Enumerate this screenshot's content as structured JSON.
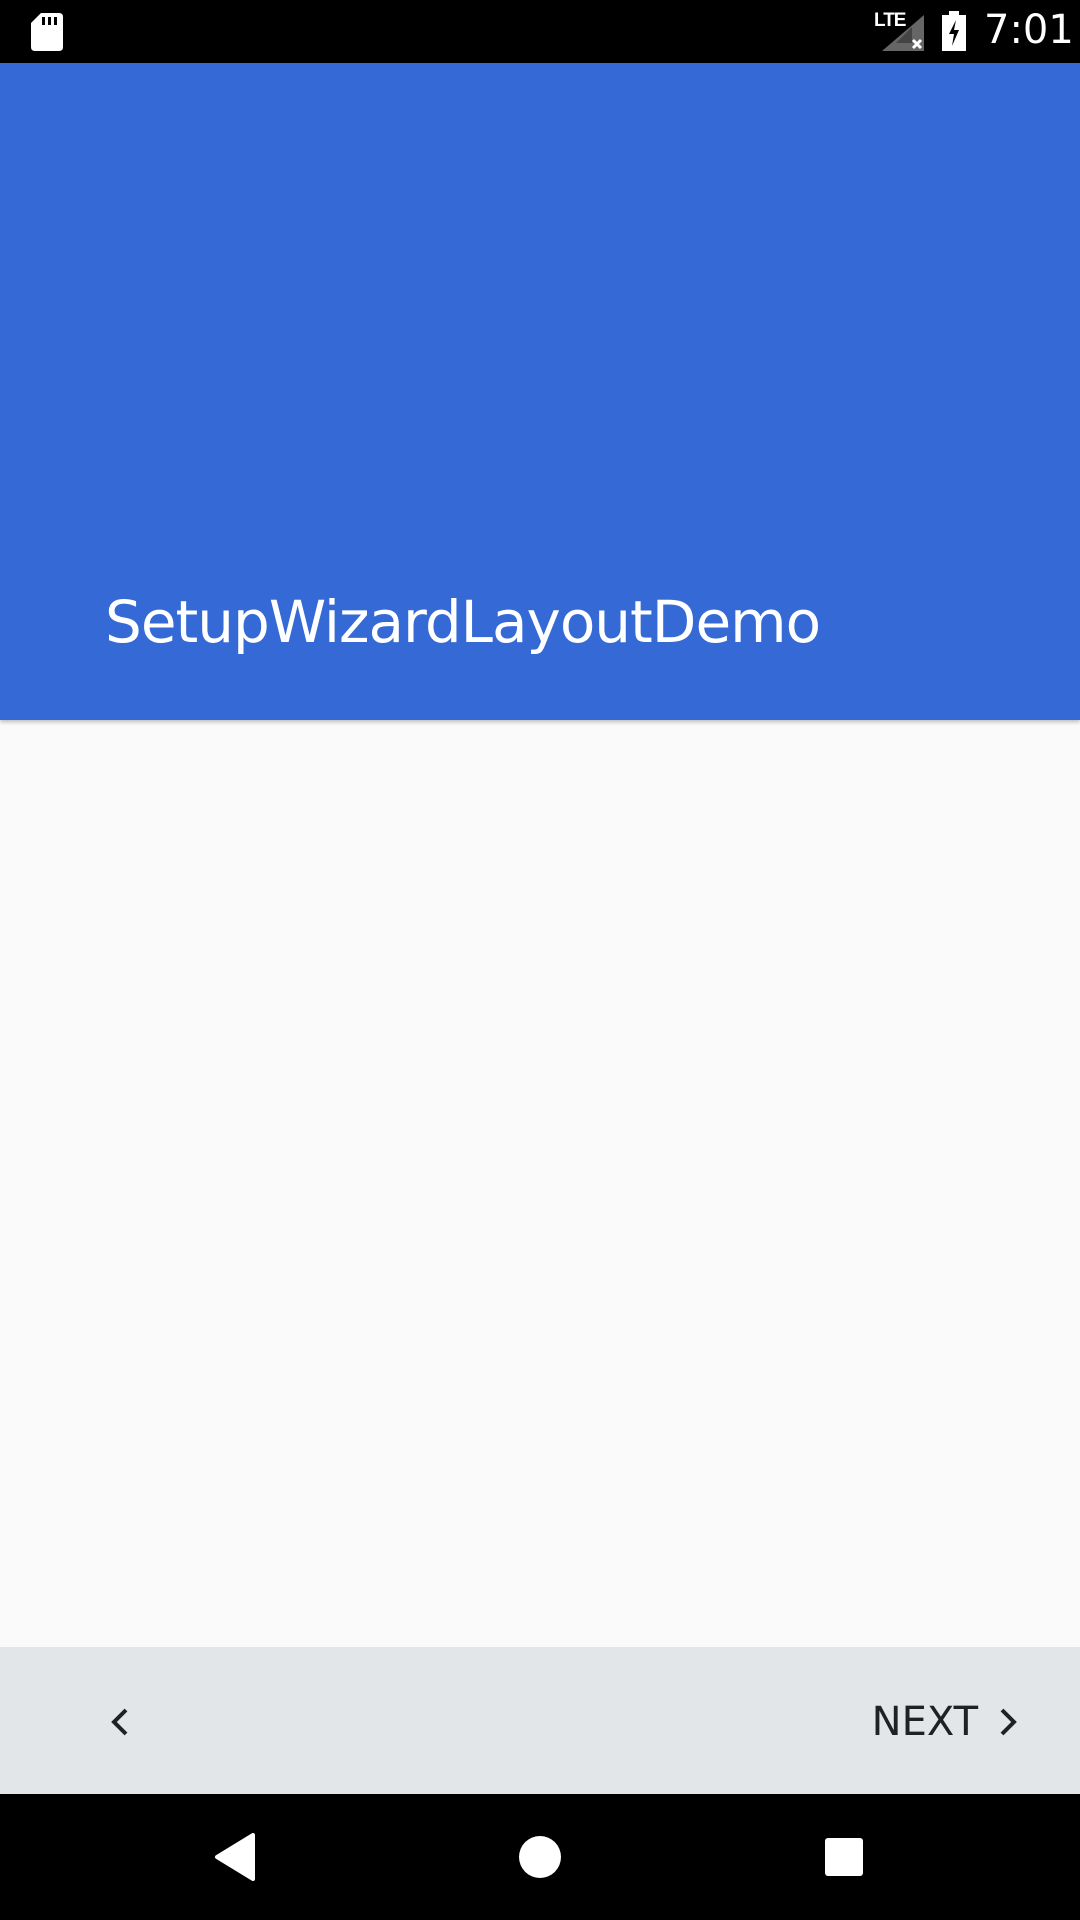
{
  "status_bar": {
    "network_label": "LTE",
    "time": "7:01",
    "icons": [
      "sd-card-icon",
      "signal-icon",
      "battery-charging-icon"
    ]
  },
  "header": {
    "title": "SetupWizardLayoutDemo",
    "background_color": "#3469d6"
  },
  "content": {
    "background_color": "#fafafa"
  },
  "wizard_nav": {
    "back_icon": "chevron-left-icon",
    "next_label": "NEXT",
    "next_icon": "chevron-right-icon",
    "background_color": "#e3e6e9"
  },
  "system_nav": {
    "icons": [
      "back-triangle-icon",
      "home-circle-icon",
      "recents-square-icon"
    ]
  }
}
